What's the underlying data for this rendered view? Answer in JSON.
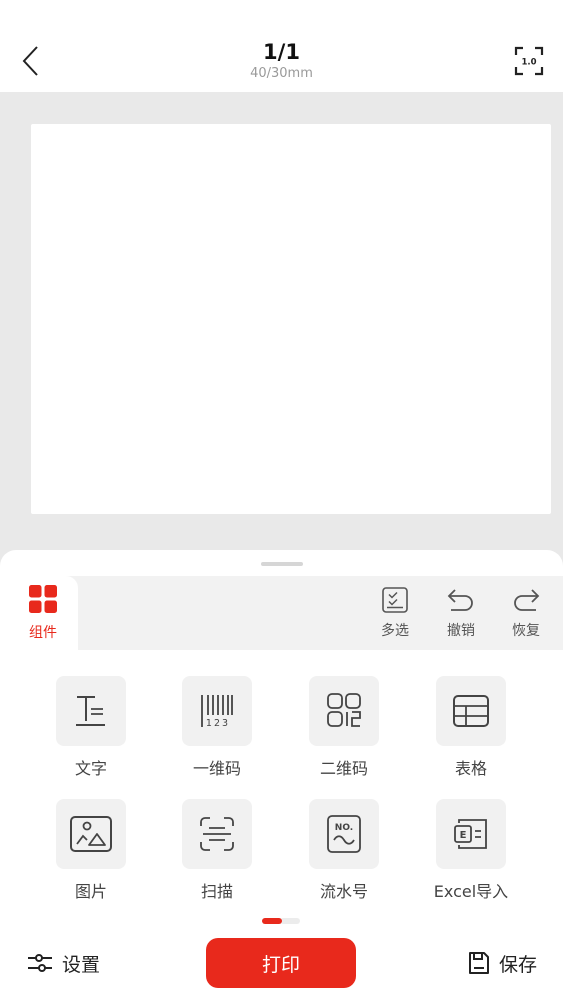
{
  "header": {
    "title": "1/1",
    "subtitle": "40/30mm",
    "fit_icon_text": "1.0"
  },
  "toolbar": {
    "active_tab": {
      "label": "组件",
      "icon": "components-grid-icon"
    },
    "tools": [
      {
        "label": "多选",
        "icon": "multi-select-icon"
      },
      {
        "label": "撤销",
        "icon": "undo-icon"
      },
      {
        "label": "恢复",
        "icon": "redo-icon"
      }
    ]
  },
  "components": [
    {
      "label": "文字",
      "icon": "text-icon"
    },
    {
      "label": "一维码",
      "icon": "barcode-icon"
    },
    {
      "label": "二维码",
      "icon": "qrcode-icon"
    },
    {
      "label": "表格",
      "icon": "table-icon"
    },
    {
      "label": "图片",
      "icon": "image-icon"
    },
    {
      "label": "扫描",
      "icon": "scan-icon"
    },
    {
      "label": "流水号",
      "icon": "serial-number-icon"
    },
    {
      "label": "Excel导入",
      "icon": "excel-import-icon"
    }
  ],
  "barcode_digits": "123",
  "serial_icon_text": "NO.",
  "excel_icon_text": "E",
  "bottom": {
    "settings_label": "设置",
    "print_label": "打印",
    "save_label": "保存"
  },
  "colors": {
    "accent": "#e8291c",
    "canvas_bg": "#e9e9e9",
    "tile_bg": "#f1f1f1"
  }
}
